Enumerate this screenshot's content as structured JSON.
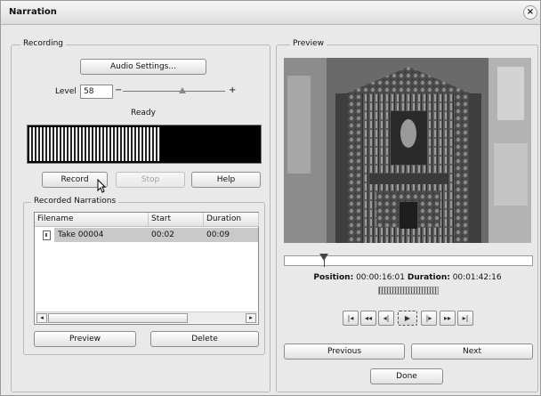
{
  "window": {
    "title": "Narration",
    "close_label": "×"
  },
  "recording": {
    "group_label": "Recording",
    "audio_settings_label": "Audio Settings...",
    "level_label": "Level",
    "level_value": "58",
    "level_fraction": 0.58,
    "slider_minus": "−",
    "slider_plus": "+",
    "status": "Ready",
    "meter_fraction": 0.57,
    "record_label": "Record",
    "stop_label": "Stop",
    "help_label": "Help"
  },
  "narrations": {
    "group_label": "Recorded Narrations",
    "columns": [
      "Filename",
      "Start",
      "Duration"
    ],
    "rows": [
      {
        "filename": "Take 00004",
        "start": "00:02",
        "duration": "00:09"
      }
    ],
    "preview_label": "Preview",
    "delete_label": "Delete"
  },
  "preview": {
    "group_label": "Preview",
    "position_label": "Position:",
    "position_value": "00:00:16:01",
    "duration_label": "Duration:",
    "duration_value": "00:01:42:16",
    "playhead_fraction": 0.16,
    "transport_icons": [
      "skip-start-icon",
      "rewind-icon",
      "step-back-icon",
      "play-icon",
      "step-forward-icon",
      "fast-forward-icon",
      "skip-end-icon"
    ],
    "previous_label": "Previous",
    "next_label": "Next",
    "done_label": "Done"
  }
}
